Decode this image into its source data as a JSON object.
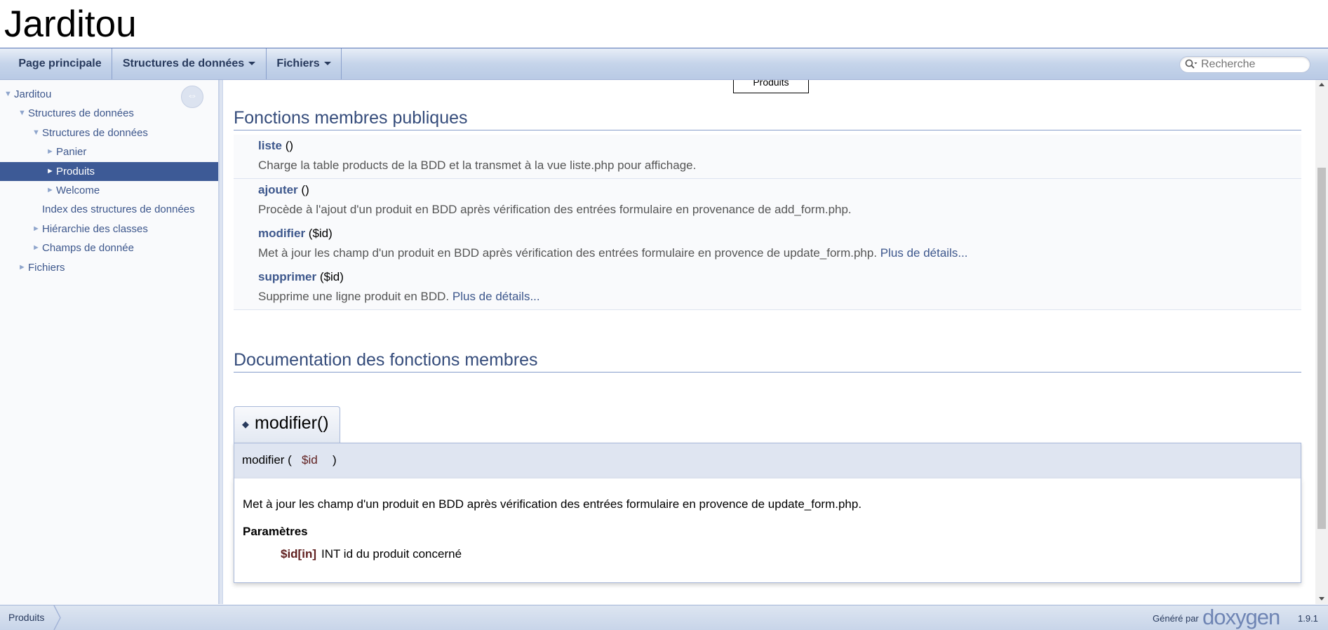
{
  "project": {
    "name": "Jarditou"
  },
  "navbar": {
    "tabs": [
      {
        "label": "Page principale",
        "has_dropdown": false
      },
      {
        "label": "Structures de données",
        "has_dropdown": true
      },
      {
        "label": "Fichiers",
        "has_dropdown": true
      }
    ],
    "search": {
      "placeholder": "Recherche",
      "icon": "search-icon"
    }
  },
  "sidebar": {
    "sync_icon": "sync-icon",
    "sync_glyph": "⇔",
    "items": [
      {
        "label": "Jarditou",
        "arrow": "▼",
        "level": 0,
        "selected": false
      },
      {
        "label": "Structures de données",
        "arrow": "▼",
        "level": 1,
        "selected": false
      },
      {
        "label": "Structures de données",
        "arrow": "▼",
        "level": 2,
        "selected": false
      },
      {
        "label": "Panier",
        "arrow": "►",
        "level": 3,
        "selected": false
      },
      {
        "label": "Produits",
        "arrow": "►",
        "level": 3,
        "selected": true
      },
      {
        "label": "Welcome",
        "arrow": "►",
        "level": 3,
        "selected": false
      },
      {
        "label": "Index des structures de données",
        "arrow": "",
        "level": 2,
        "selected": false
      },
      {
        "label": "Hiérarchie des classes",
        "arrow": "►",
        "level": 2,
        "selected": false
      },
      {
        "label": "Champs de donnée",
        "arrow": "►",
        "level": 2,
        "selected": false
      },
      {
        "label": "Fichiers",
        "arrow": "►",
        "level": 1,
        "selected": false
      }
    ]
  },
  "content": {
    "class_box": "Produits",
    "public_functions_heading": "Fonctions membres publiques",
    "members": [
      {
        "name": "liste",
        "args": " ()",
        "desc": "Charge la table products de la BDD et la transmet à la vue liste.php pour affichage.",
        "more": ""
      },
      {
        "name": "ajouter",
        "args": " ()",
        "desc": "Procède à l'ajout d'un produit en BDD après vérification des entrées formulaire en provenance de add_form.php.",
        "more": ""
      },
      {
        "name": "modifier",
        "args": " ($id)",
        "desc": "Met à jour les champ d'un produit en BDD après vérification des entrées formulaire en provence de update_form.php. ",
        "more": "Plus de détails..."
      },
      {
        "name": "supprimer",
        "args": " ($id)",
        "desc": "Supprime une ligne produit en BDD. ",
        "more": "Plus de détails..."
      }
    ],
    "doc_heading": "Documentation des fonctions membres",
    "memitem": {
      "diamond": "◆",
      "title": "modifier()",
      "proto_name": "modifier (",
      "proto_param": "$id",
      "proto_close": ")",
      "description": "Met à jour les champ d'un produit en BDD après vérification des entrées formulaire en provence de update_form.php.",
      "params_heading": "Paramètres",
      "param_name": "$id[in]",
      "param_desc": "INT id du produit concerné"
    }
  },
  "footer": {
    "breadcrumb": "Produits",
    "generated_by": "Généré par",
    "doxygen": "doxygen",
    "version": "1.9.1"
  },
  "colors": {
    "link": "#3d578c",
    "selected_bg": "#3d5a96",
    "heading": "#354c7b",
    "param": "#602020"
  }
}
